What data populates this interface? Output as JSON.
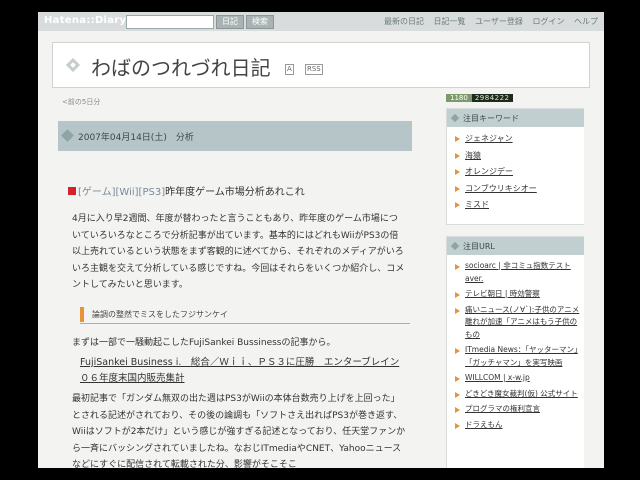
{
  "topbar": {
    "logo": "Hatena::Diary",
    "search_placeholder": "",
    "button1": "日記",
    "button2": "検索",
    "nav": [
      "最新の日記",
      "日記一覧",
      "ユーザー登録",
      "ログイン",
      "ヘルプ"
    ]
  },
  "header": {
    "title": "わばのつれづれ日記",
    "mini1": "A",
    "mini2": "RSS"
  },
  "date_nav": "<前の5日分",
  "entry": {
    "day_header": "2007年04月14日(土)　分析",
    "section_prefix1": "[ゲーム]",
    "section_prefix2": "[Wii]",
    "section_prefix3": "[PS3]",
    "section_title": "昨年度ゲーム市場分析あれこれ",
    "para1": "4月に入り早2週間、年度が替わったと言うこともあり、昨年度のゲーム市場についていろいろなところで分析記事が出ています。基本的にはどれもWiiがPS3の倍以上売れているという状態をまず客観的に述べてから、それぞれのメディアがいろいろ主観を交えて分析している感じですね。今回はそれらをいくつか紹介し、コメントしてみたいと思います。",
    "sub_heading": "論調の整然でミスをしたフジサンケイ",
    "para2": "まずは一部で一騒動起こしたFujiSankei Bussinessの記事から。",
    "link_title": "FujiSankei Business i.　総合／Ｗｉｉ、ＰＳ３に圧勝　エンターブレイン０６年度末国内販売集計",
    "para3": "最初記事で「ガンダム無双の出た週はPS3がWiiの本体台数売り上げを上回った」とされる記述がされており、その後の論調も「ソフトさえ出ればPS3が巻き返す、Wiiはソフトが2本だけ」という感じが強すぎる記述となっており、任天堂ファンから一斉にバッシングされていましたね。なおじITmediaやCNET、Yahooニュースなどにすぐに配信されて転載された分、影響がそこそこ"
  },
  "sidebar": {
    "counter_label": "1180",
    "counter_value": "2984222",
    "keywords_title": "注目キーワード",
    "keywords": [
      "ジェネジャン",
      "海猿",
      "オレンジデー",
      "コンブウリキシオー",
      "ミスド"
    ],
    "urls_title": "注目URL",
    "urls": [
      "socioarc | 非コミュ指数テスト aver.",
      "テレビ朝日 | 時効警察",
      "痛いニュース(ノ∀`):子供のアニメ離れが加速「アニメはもう子供のもの",
      "ITmedia News：「ヤッターマン」「ガッチャマン」を実写映画",
      "WILLCOM | x-w.jp",
      "どきどき魔女裁判(仮) 公式サイト",
      "プログラマの権利宣言",
      "ドラえもん"
    ]
  },
  "colors": {
    "accent_orange": "#e8923a",
    "header_blue_gray": "#b6c5c7",
    "red_square": "#d2222a"
  }
}
